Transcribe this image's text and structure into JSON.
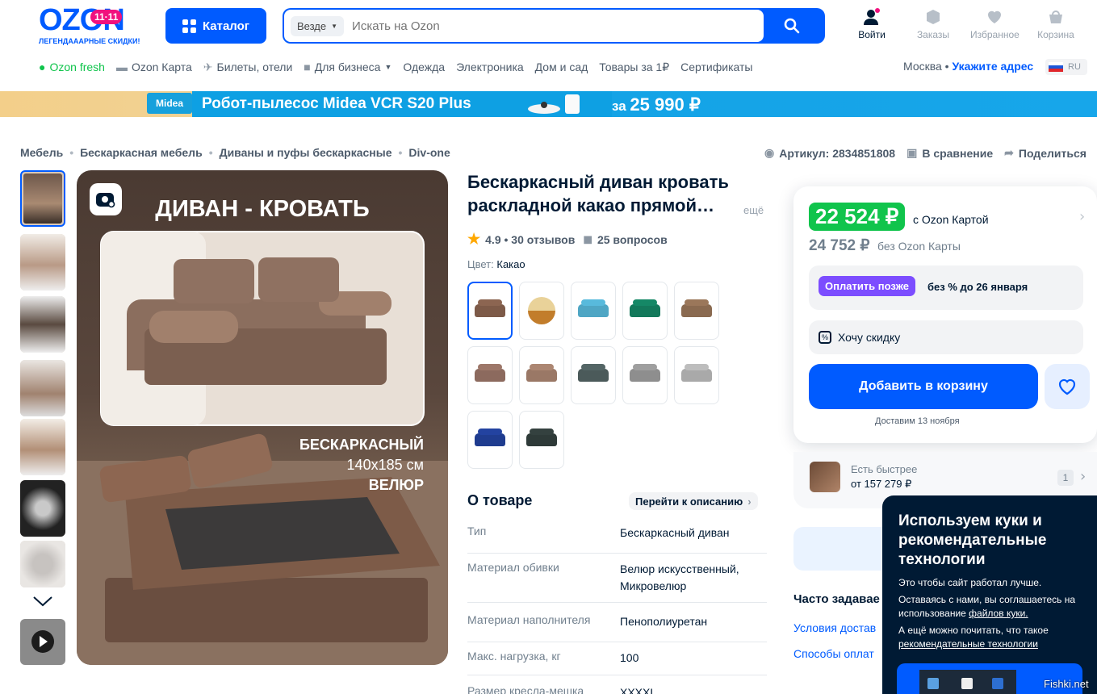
{
  "header": {
    "logo": "OZON",
    "logo_badge": "11·11",
    "logo_tagline": "ЛЕГЕНДАААРНЫЕ СКИДКИ!",
    "catalog": "Каталог",
    "search_scope": "Везде",
    "search_placeholder": "Искать на Ozon",
    "icons": [
      {
        "label": "Войти",
        "icon": "user-icon"
      },
      {
        "label": "Заказы",
        "icon": "box-icon"
      },
      {
        "label": "Избранное",
        "icon": "heart-icon"
      },
      {
        "label": "Корзина",
        "icon": "cart-icon"
      }
    ]
  },
  "nav": [
    "Ozon fresh",
    "Ozon Карта",
    "Билеты, отели",
    "Для бизнеса",
    "Одежда",
    "Электроника",
    "Дом и сад",
    "Товары за 1₽",
    "Сертификаты"
  ],
  "location": {
    "city": "Москва",
    "address": "Укажите адрес",
    "lang": "RU"
  },
  "banner": {
    "brand": "Midea",
    "text": "Робот-пылесос  Midea VCR S20 Plus",
    "price_prefix": "за",
    "price": "25 990 ₽"
  },
  "breadcrumbs": [
    "Мебель",
    "Бескаркасная мебель",
    "Диваны и пуфы бескаркасные",
    "Div-one"
  ],
  "tools": {
    "sku": "Артикул: 2834851808",
    "compare": "В сравнение",
    "share": "Поделиться"
  },
  "main_image": {
    "heading": "ДИВАН - КРОВАТЬ",
    "line1": "БЕСКАРКАСНЫЙ",
    "line2": "140х185 см",
    "line3": "ВЕЛЮР"
  },
  "product": {
    "title": "Бескаркасный диван кровать раскладной какао прямой…",
    "more": "ещё",
    "rating": "4.9 • 30 отзывов",
    "questions": "25 вопросов",
    "color_label": "Цвет:",
    "color_value": "Какао"
  },
  "swatches": [
    "#7d5a48",
    "#c88a3a",
    "#4fa6c4",
    "#13795b",
    "#8a6a50",
    "#8c6a5e",
    "#9a7866",
    "#4b5a5a",
    "#8e8e8e",
    "#a9a9a9",
    "#1f3c8f",
    "#2e3a38"
  ],
  "about": {
    "title": "О товаре",
    "link": "Перейти к описанию",
    "specs": [
      {
        "k": "Тип",
        "v": "Бескаркасный диван"
      },
      {
        "k": "Материал обивки",
        "v": "Велюр искусственный, Микровелюр"
      },
      {
        "k": "Материал наполнителя",
        "v": "Пенополиуретан"
      },
      {
        "k": "Макс. нагрузка, кг",
        "v": "100"
      },
      {
        "k": "Размер кресла-мешка",
        "v": "XXXXL"
      }
    ]
  },
  "buy": {
    "price": "22 524 ₽",
    "price_label": "с Ozon Картой",
    "price2": "24 752 ₽",
    "price2_label": "без Ozon Карты",
    "pay_later": "Оплатить позже",
    "pay_later_text": "без % до 26 января",
    "discount": "Хочу скидку",
    "add_cart": "Добавить в корзину",
    "delivery": "Доставим 13 ноября",
    "faster_l1": "Есть быстрее",
    "faster_l2": "от 157 279 ₽",
    "faster_count": "1"
  },
  "faq": {
    "title": "Часто задавае",
    "links": [
      "Условия достав",
      "Способы оплат"
    ]
  },
  "cookie": {
    "title": "Используем куки и рекомендательные технологии",
    "p1": "Это чтобы сайт работал лучше.",
    "p2a": "Оставаясь с нами, вы соглашаетесь на использование ",
    "p2b": "файлов куки.",
    "p3a": "А ещё можно почитать, что такое ",
    "p3b": "рекомендательные технологии"
  },
  "watermark": "Fishki.net"
}
